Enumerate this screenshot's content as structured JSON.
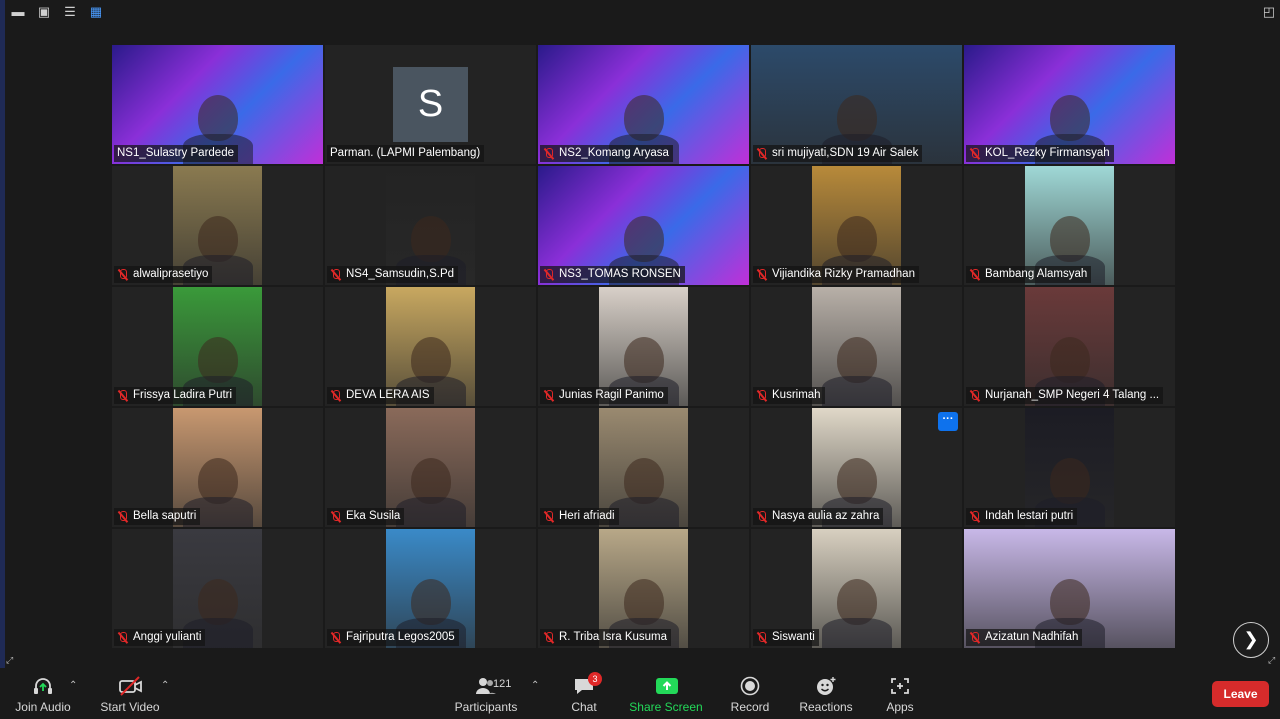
{
  "window": {
    "top_icons": [
      "minimize-icon",
      "restore-icon",
      "menu-icon",
      "gallery-view-icon"
    ],
    "fullscreen_icon": "exit-fullscreen-icon"
  },
  "participants": [
    {
      "name": "NS1_Sulastry Pardede",
      "muted": false,
      "bg": "#6a2fb8"
    },
    {
      "name": "Parman. (LAPMI Palembang)",
      "muted": false,
      "avatar_letter": "S",
      "bg": "#232323"
    },
    {
      "name": "NS2_Komang Aryasa",
      "muted": true,
      "bg": "#6a2fb8"
    },
    {
      "name": "sri mujiyati,SDN 19 Air Salek",
      "muted": true,
      "bg": "#2c4a6a"
    },
    {
      "name": "KOL_Rezky Firmansyah",
      "muted": true,
      "bg": "#6a2fb8"
    },
    {
      "name": "alwaliprasetiyo",
      "muted": true,
      "bg": "#8a7a50"
    },
    {
      "name": "NS4_Samsudin,S.Pd",
      "muted": true,
      "bg": "#232323"
    },
    {
      "name": "NS3_TOMAS RONSEN",
      "muted": true,
      "bg": "#6a2fb8"
    },
    {
      "name": "Vijiandika Rizky Pramadhan",
      "muted": true,
      "bg": "#b88a3a"
    },
    {
      "name": "Bambang Alamsyah",
      "muted": true,
      "bg": "#9fd8d6"
    },
    {
      "name": "Frissya Ladira Putri",
      "muted": true,
      "bg": "#3a9a3a"
    },
    {
      "name": "DEVA LERA AIS",
      "muted": true,
      "bg": "#c8a860"
    },
    {
      "name": "Junias Ragil Panimo",
      "muted": true,
      "bg": "#d8d0c8"
    },
    {
      "name": "Kusrimah",
      "muted": true,
      "bg": "#b8b0a8"
    },
    {
      "name": "Nurjanah_SMP Negeri 4 Talang ...",
      "muted": true,
      "bg": "#6a3a3a"
    },
    {
      "name": "Bella saputri",
      "muted": true,
      "bg": "#c89870"
    },
    {
      "name": "Eka Susila",
      "muted": true,
      "bg": "#8a6a5a"
    },
    {
      "name": "Heri afriadi",
      "muted": true,
      "bg": "#9a8a70"
    },
    {
      "name": "Nasya aulia az zahra",
      "muted": true,
      "bg": "#e0d8c8"
    },
    {
      "name": "Indah lestari putri",
      "muted": true,
      "bg": "#1c1c24"
    },
    {
      "name": "Anggi yulianti",
      "muted": true,
      "bg": "#3a3a40"
    },
    {
      "name": "Fajriputra Legos2005",
      "muted": true,
      "bg": "#3a8ac8"
    },
    {
      "name": "R. Triba Isra Kusuma",
      "muted": true,
      "bg": "#b8a888"
    },
    {
      "name": "Siswanti",
      "muted": true,
      "bg": "#d8d0c0"
    },
    {
      "name": "Azizatun Nadhifah",
      "muted": true,
      "bg": "#c8b8e8"
    }
  ],
  "toolbar": {
    "join_audio": "Join Audio",
    "start_video": "Start Video",
    "participants": "Participants",
    "participants_count": "121",
    "chat": "Chat",
    "chat_badge": "3",
    "share_screen": "Share Screen",
    "record": "Record",
    "reactions": "Reactions",
    "apps": "Apps",
    "leave": "Leave"
  },
  "colors": {
    "accent_green": "#23d959",
    "leave_red": "#d62b2b",
    "mute_red": "#e02828",
    "blue": "#0e72ed"
  }
}
